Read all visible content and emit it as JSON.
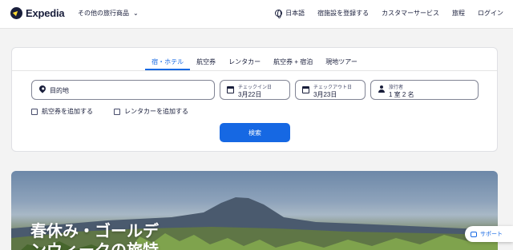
{
  "header": {
    "logo_text": "Expedia",
    "more_travel": "その他の旅行商品",
    "nav": {
      "language": "日本語",
      "list_property": "宿施設を登録する",
      "customer_service": "カスタマーサービス",
      "trips": "旅程",
      "login": "ログイン"
    }
  },
  "search": {
    "tabs": [
      {
        "label": "宿・ホテル",
        "active": true
      },
      {
        "label": "航空券",
        "active": false
      },
      {
        "label": "レンタカー",
        "active": false
      },
      {
        "label": "航空券 + 宿泊",
        "active": false
      },
      {
        "label": "現地ツアー",
        "active": false
      }
    ],
    "destination_placeholder": "目的地",
    "checkin": {
      "label": "チェックイン日",
      "value": "3月22日"
    },
    "checkout": {
      "label": "チェックアウト日",
      "value": "3月23日"
    },
    "travelers": {
      "label": "旅行者",
      "value": "1 室 2 名"
    },
    "add_flight": "航空券を追加する",
    "add_car": "レンタカーを追加する",
    "search_button": "検索"
  },
  "hero": {
    "title": "春休み・ゴールデ\nンウィークの旅特"
  },
  "support": {
    "label": "サポート"
  },
  "colors": {
    "accent": "#1668e3",
    "text": "#191e3b",
    "logo_yellow": "#fddb32"
  }
}
